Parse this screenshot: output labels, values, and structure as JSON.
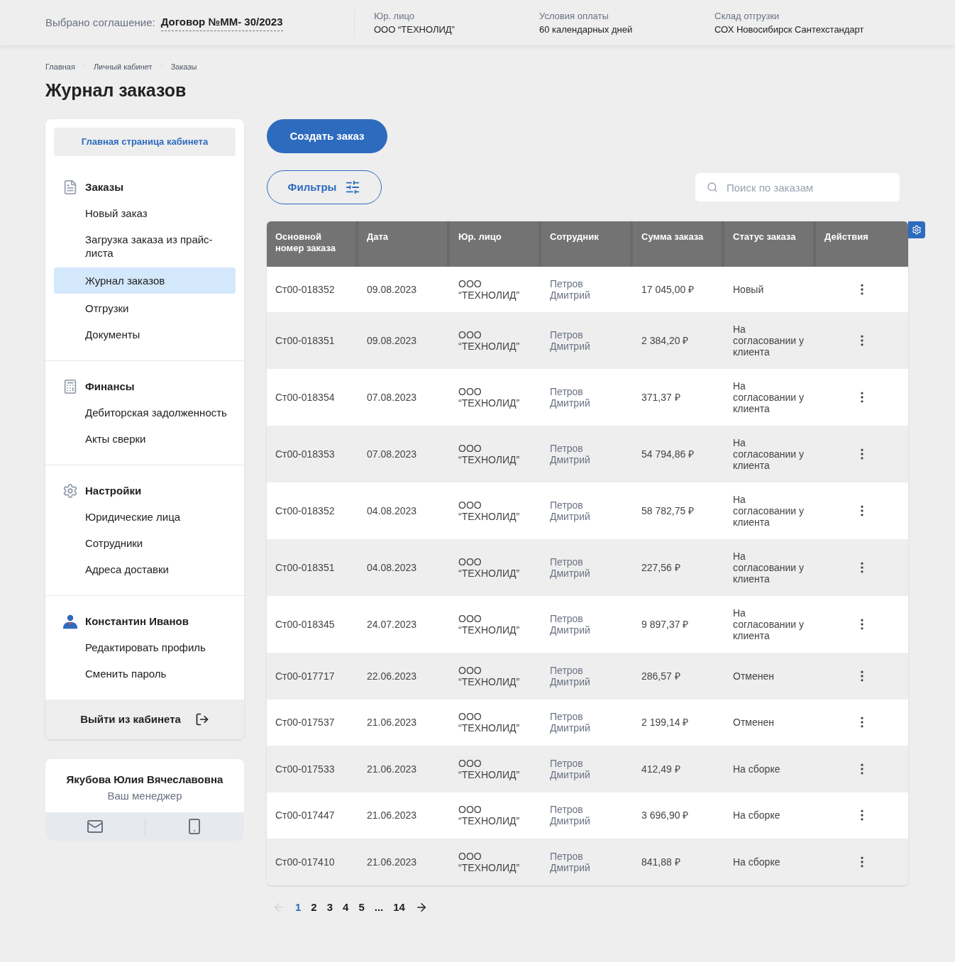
{
  "top_bar": {
    "agreement_label": "Выбрано соглашение:",
    "agreement_value": "Договор №ММ- 30/2023",
    "fields": [
      {
        "label": "Юр. лицо",
        "value": "ООО “ТЕХНОЛИД”"
      },
      {
        "label": "Условия оплаты",
        "value": "60 календарных дней"
      },
      {
        "label": "Склад отгрузки",
        "value": "СОХ Новосибирск Сантехстандарт"
      }
    ]
  },
  "breadcrumbs": [
    "Главная",
    "Личный кабинет",
    "Заказы"
  ],
  "page_title": "Журнал заказов",
  "sidebar": {
    "home_button": "Главная страница кабинета",
    "sections": [
      {
        "kind": "document",
        "title": "Заказы",
        "items": [
          {
            "label": "Новый заказ",
            "selected": false
          },
          {
            "label": "Загрузка заказа из прайс-листа",
            "selected": false
          },
          {
            "label": "Журнал заказов",
            "selected": true
          },
          {
            "label": "Отгрузки",
            "selected": false
          },
          {
            "label": "Документы",
            "selected": false
          }
        ]
      },
      {
        "kind": "calculator",
        "title": "Финансы",
        "items": [
          {
            "label": "Дебиторская задолженность",
            "selected": false
          },
          {
            "label": "Акты сверки",
            "selected": false
          }
        ]
      },
      {
        "kind": "gear",
        "title": "Настройки",
        "items": [
          {
            "label": "Юридические лица",
            "selected": false
          },
          {
            "label": "Сотрудники",
            "selected": false
          },
          {
            "label": "Адреса доставки",
            "selected": false
          }
        ]
      },
      {
        "kind": "person",
        "title": "Константин Иванов",
        "items": [
          {
            "label": "Редактировать профиль",
            "selected": false
          },
          {
            "label": "Сменить пароль",
            "selected": false
          }
        ]
      }
    ],
    "logout_button": "Выйти из кабинета"
  },
  "manager": {
    "name": "Якубова Юлия Вячеславовна",
    "role": "Ваш менеджер"
  },
  "create_button": "Создать заказ",
  "filters_button": "Фильтры",
  "search": {
    "placeholder": "Поиск по заказам"
  },
  "table": {
    "columns": [
      "Основной номер заказа",
      "Дата",
      "Юр. лицо",
      "Сотрудник",
      "Сумма заказа",
      "Статус заказа",
      "Действия"
    ],
    "rows": [
      [
        "Ст00-018352",
        "09.08.2023",
        "ООО “ТЕХНОЛИД”",
        "Петров Дмитрий",
        "17 045,00 ₽",
        "Новый"
      ],
      [
        "Ст00-018351",
        "09.08.2023",
        "ООО “ТЕХНОЛИД”",
        "Петров Дмитрий",
        "2 384,20 ₽",
        "На согласовании у клиента"
      ],
      [
        "Ст00-018354",
        "07.08.2023",
        "ООО “ТЕХНОЛИД”",
        "Петров Дмитрий",
        "371,37 ₽",
        "На согласовании у клиента"
      ],
      [
        "Ст00-018353",
        "07.08.2023",
        "ООО “ТЕХНОЛИД”",
        "Петров Дмитрий",
        "54 794,86 ₽",
        "На согласовании у клиента"
      ],
      [
        "Ст00-018352",
        "04.08.2023",
        "ООО “ТЕХНОЛИД”",
        "Петров Дмитрий",
        "58 782,75 ₽",
        "На согласовании у клиента"
      ],
      [
        "Ст00-018351",
        "04.08.2023",
        "ООО “ТЕХНОЛИД”",
        "Петров Дмитрий",
        "227,56 ₽",
        "На согласовании у клиента"
      ],
      [
        "Ст00-018345",
        "24.07.2023",
        "ООО “ТЕХНОЛИД”",
        "Петров Дмитрий",
        "9 897,37 ₽",
        "На согласовании у клиента"
      ],
      [
        "Ст00-017717",
        "22.06.2023",
        "ООО “ТЕХНОЛИД”",
        "Петров Дмитрий",
        "286,57 ₽",
        "Отменен"
      ],
      [
        "Ст00-017537",
        "21.06.2023",
        "ООО “ТЕХНОЛИД”",
        "Петров Дмитрий",
        "2 199,14 ₽",
        "Отменен"
      ],
      [
        "Ст00-017533",
        "21.06.2023",
        "ООО “ТЕХНОЛИД”",
        "Петров Дмитрий",
        "412,49 ₽",
        "На сборке"
      ],
      [
        "Ст00-017447",
        "21.06.2023",
        "ООО “ТЕХНОЛИД”",
        "Петров Дмитрий",
        "3 696,90 ₽",
        "На сборке"
      ],
      [
        "Ст00-017410",
        "21.06.2023",
        "ООО “ТЕХНОЛИД”",
        "Петров Дмитрий",
        "841,88 ₽",
        "На сборке"
      ]
    ]
  },
  "pagination": {
    "prev_disabled": true,
    "next_disabled": false,
    "pages": [
      {
        "label": "1",
        "selected": true
      },
      {
        "label": "2",
        "selected": false
      },
      {
        "label": "3",
        "selected": false
      },
      {
        "label": "4",
        "selected": false
      },
      {
        "label": "5",
        "selected": false
      },
      {
        "label": "...",
        "selected": false
      },
      {
        "label": "14",
        "selected": false
      }
    ]
  }
}
